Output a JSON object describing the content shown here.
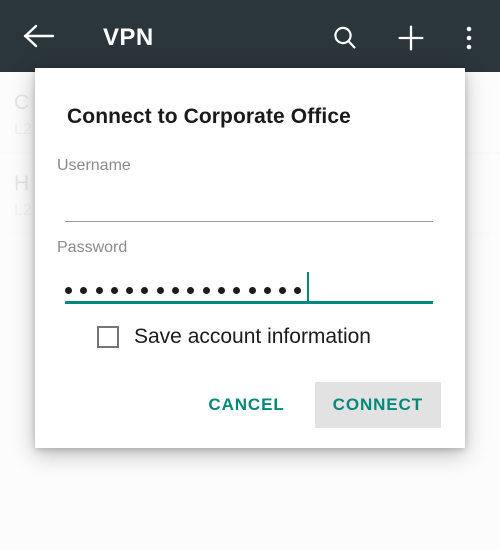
{
  "appbar": {
    "title": "VPN",
    "back_icon": "back-arrow-icon",
    "search_icon": "search-icon",
    "add_icon": "plus-icon",
    "overflow_icon": "overflow-menu-icon",
    "background_color": "#2b353c"
  },
  "background_list": {
    "items": [
      {
        "title": "C",
        "subtitle": "L2"
      },
      {
        "title": "H",
        "subtitle": "L2"
      }
    ]
  },
  "dialog": {
    "title": "Connect to Corporate Office",
    "username": {
      "label": "Username",
      "value": "",
      "focused": false
    },
    "password": {
      "label": "Password",
      "masked_value": "••••••••••••••••",
      "dot_count": 16,
      "focused": true
    },
    "checkbox": {
      "label": "Save account information",
      "checked": false
    },
    "cancel_label": "CANCEL",
    "connect_label": "CONNECT",
    "accent_color": "#00897b",
    "connect_button_background": "#e2e2e2"
  }
}
